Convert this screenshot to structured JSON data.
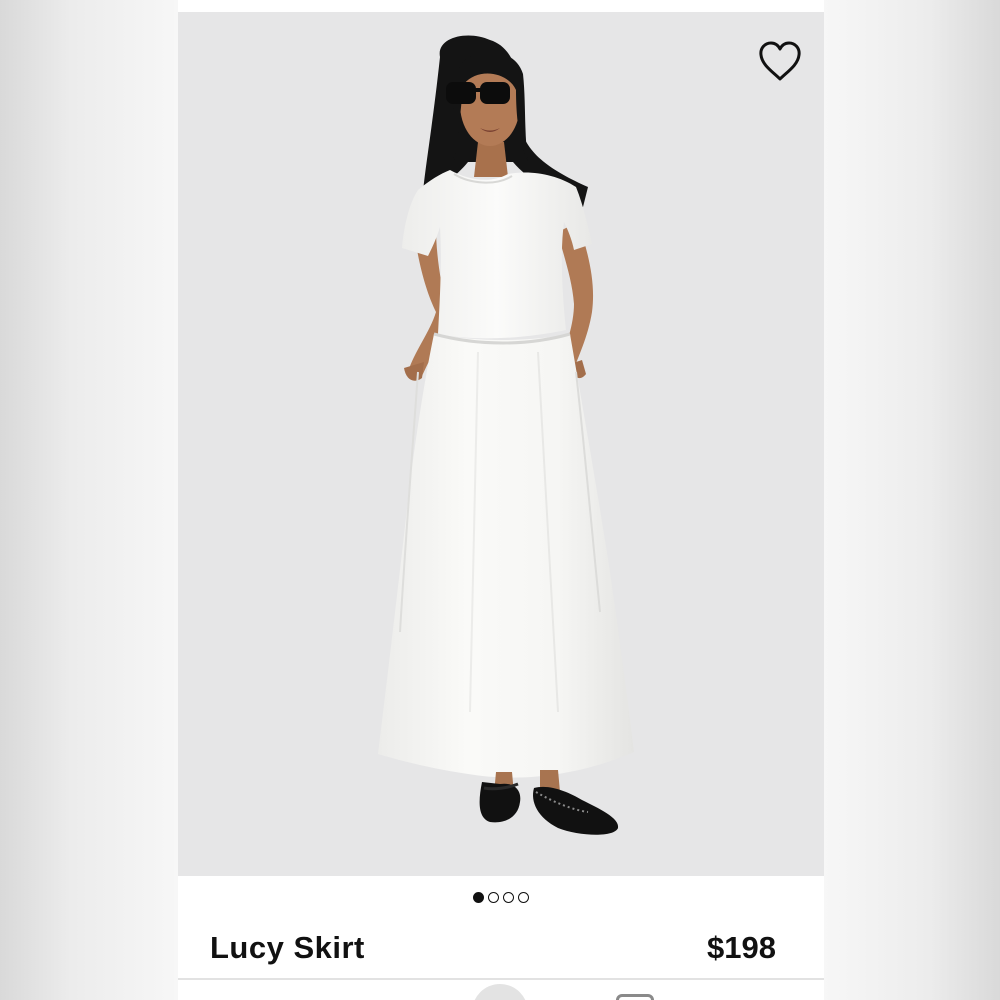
{
  "product": {
    "name": "Lucy Skirt",
    "price": "$198"
  },
  "gallery": {
    "total_images": 4,
    "active_index": 0
  },
  "icons": {
    "favorite": "heart-outline-icon"
  },
  "colors": {
    "photo_background": "#e6e6e7",
    "text": "#111111",
    "garment": "#f7f7f5"
  }
}
